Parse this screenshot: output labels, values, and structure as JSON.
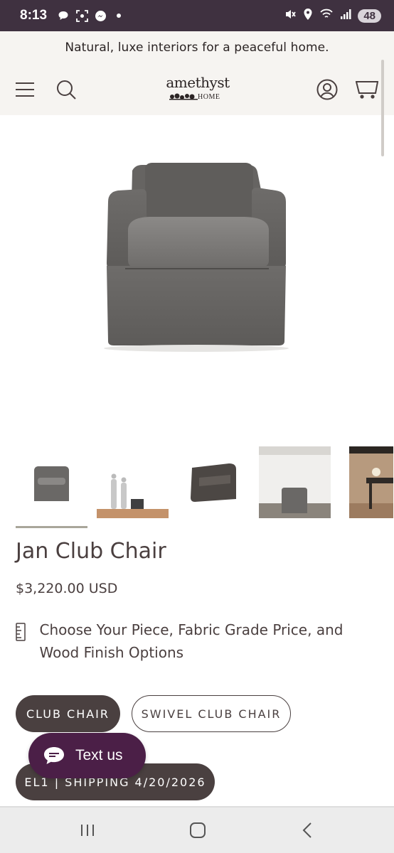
{
  "status_bar": {
    "time": "8:13",
    "battery": "48",
    "left_icons": [
      "chat-bubble-icon",
      "screenshot-icon",
      "messenger-icon",
      "dot-icon"
    ],
    "right_icons": [
      "mute-icon",
      "location-icon",
      "wifi-icon",
      "signal-icon"
    ]
  },
  "announcement": {
    "text": "Natural, luxe interiors for a peaceful home."
  },
  "header": {
    "logo_main": "amethyst",
    "logo_sub": "HOME",
    "icons": [
      "menu-icon",
      "search-icon",
      "account-icon",
      "cart-icon"
    ]
  },
  "gallery": {
    "thumbnail_count": 5,
    "selected_index": 0
  },
  "product": {
    "title": "Jan Club Chair",
    "price": "$3,220.00 USD",
    "options_note": "Choose Your Piece, Fabric Grade Price, and Wood Finish Options",
    "options": [
      {
        "label": "CLUB CHAIR",
        "selected": true
      },
      {
        "label": "SWIVEL CLUB CHAIR",
        "selected": false
      }
    ],
    "shipping_label": "EL1 | SHIPPING 4/20/2026"
  },
  "chat": {
    "label": "Text us"
  },
  "colors": {
    "status_bar": "#3f3140",
    "header_bg": "#f6f4f1",
    "pill_dark": "#4a4040",
    "chat": "#4b1f47"
  }
}
